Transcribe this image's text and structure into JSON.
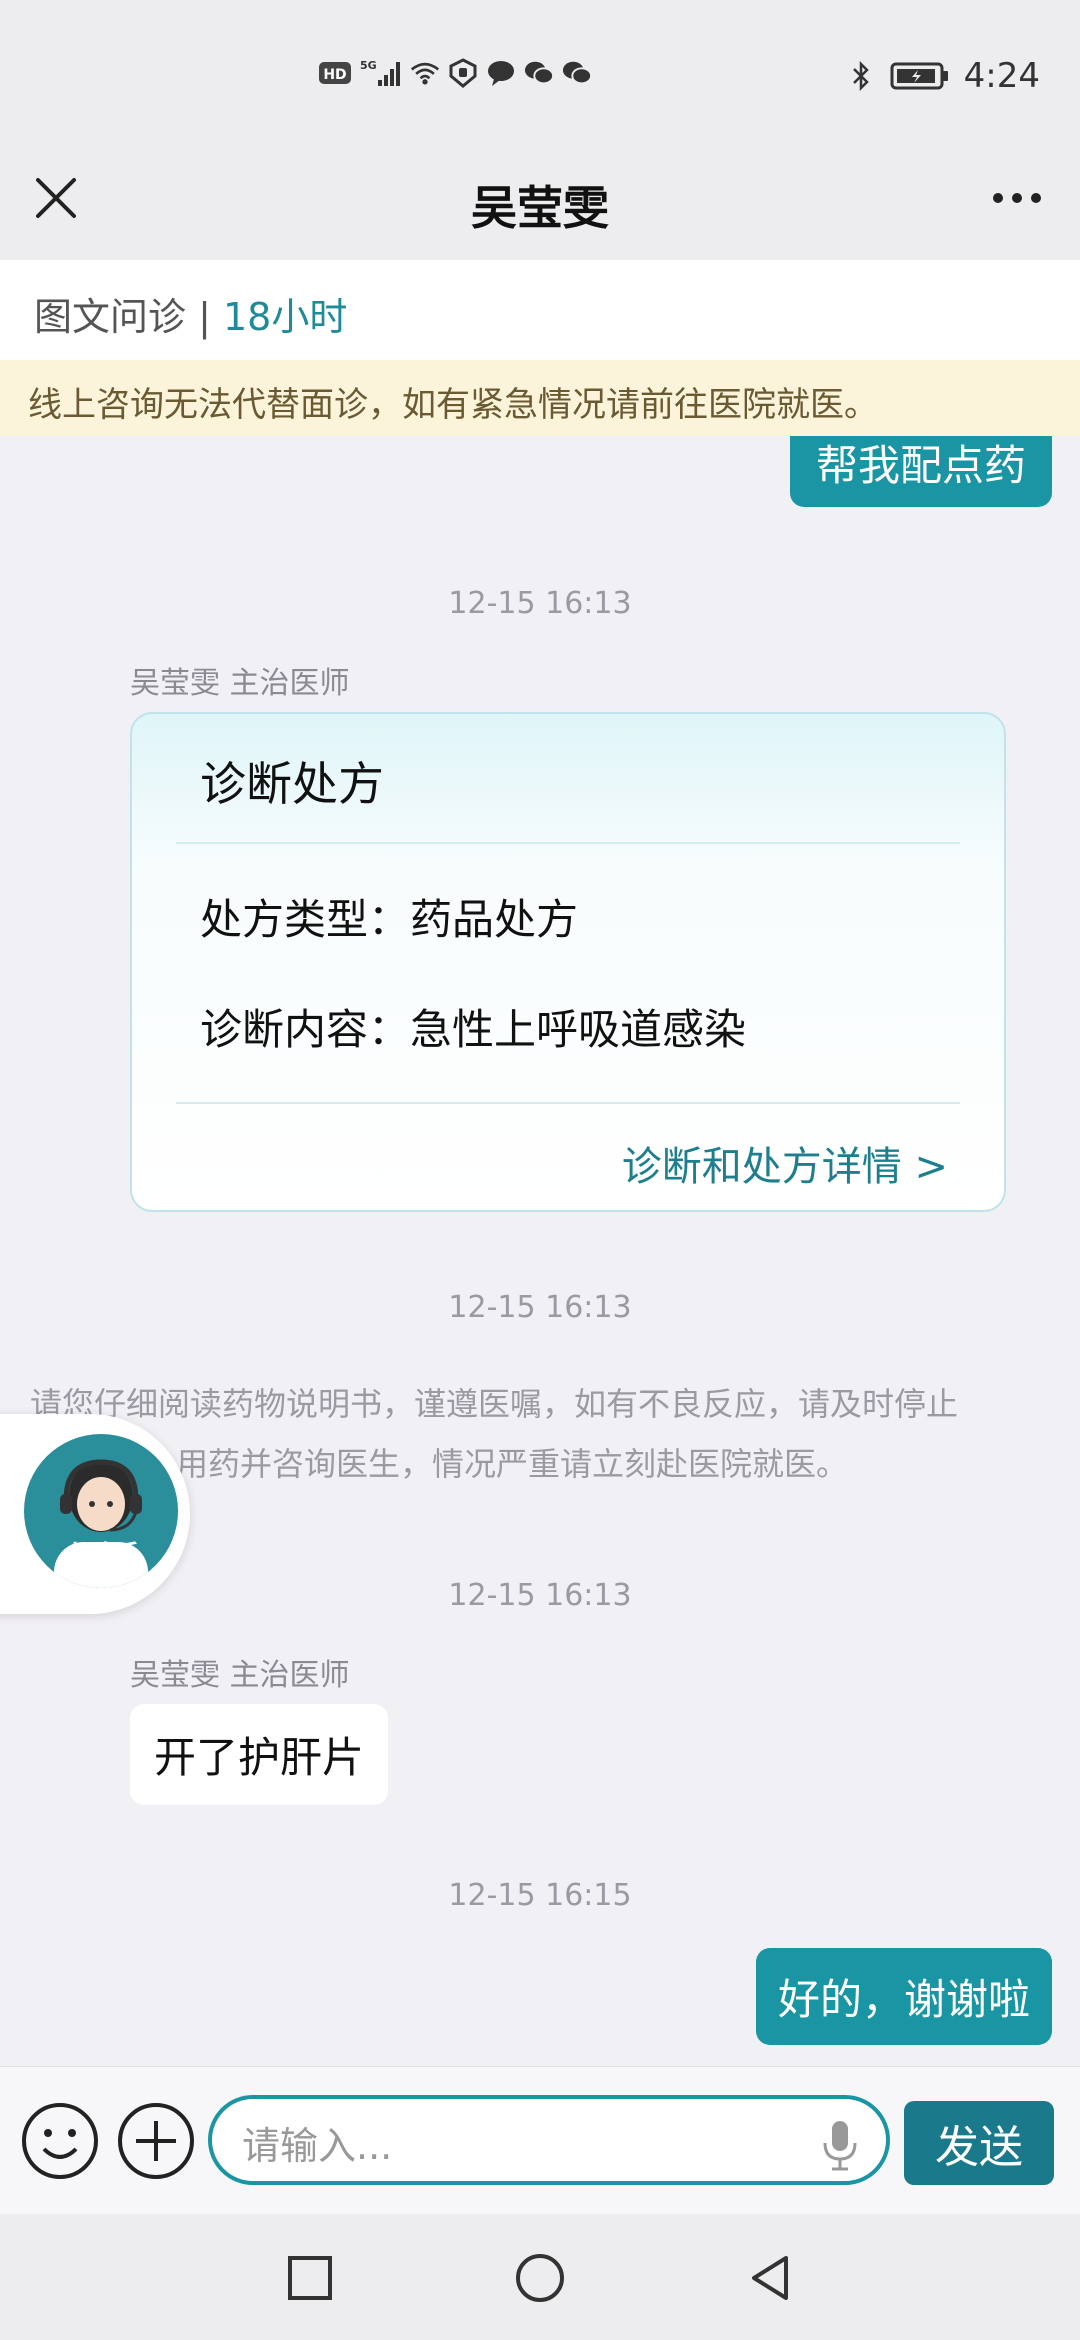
{
  "status_bar": {
    "hd": "HD",
    "network": "5G",
    "time": "4:24"
  },
  "header": {
    "title": "吴莹雯"
  },
  "consult": {
    "type": "图文问诊",
    "separator": " | ",
    "hours": "18小时"
  },
  "notice": "线上咨询无法代替面诊，如有紧急情况请前往医院就医。",
  "messages": {
    "m1_text": "帮我配点药",
    "ts1": "12-15 16:13",
    "doctor_label_1": "吴莹雯 主治医师",
    "rx": {
      "title": "诊断处方",
      "type_label": "处方类型：",
      "type_value": "药品处方",
      "diag_label": "诊断内容：",
      "diag_value": "急性上呼吸道感染",
      "link": "诊断和处方详情 >"
    },
    "ts2": "12-15 16:13",
    "sys_line1": "请您仔细阅读药物说明书，谨遵医嘱，如有不良反应，请及时停止",
    "sys_line2": "用药并咨询医生，情况严重请立刻赴医院就医。",
    "ts3": "12-15 16:13",
    "doctor_label_2": "吴莹雯 主治医师",
    "m2_text": "开了护肝片",
    "ts4": "12-15 16:15",
    "m3_text": "好的，谢谢啦"
  },
  "assistant": {
    "label": "小助手"
  },
  "input": {
    "placeholder": "请输入...",
    "send_label": "发送"
  },
  "colors": {
    "accent": "#1a95a4",
    "send": "#1a7a8c",
    "notice_bg": "#fbf3da"
  }
}
